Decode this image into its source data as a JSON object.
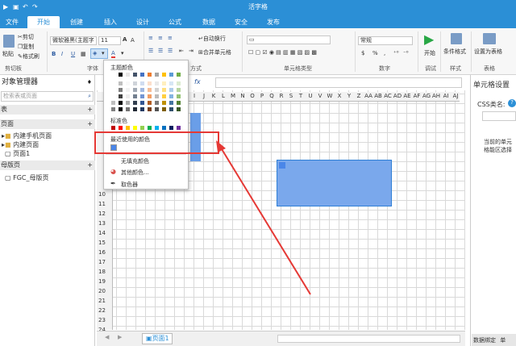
{
  "app": {
    "title": "活字格"
  },
  "menu": {
    "file": "文件",
    "tabs": [
      "开始",
      "创建",
      "插入",
      "设计",
      "公式",
      "数据",
      "安全",
      "发布"
    ]
  },
  "ribbon": {
    "paste": "粘贴",
    "cut": "剪切",
    "copy": "复制",
    "format_painter": "格式刷",
    "font_name": "微软雅黑(主题字",
    "font_size": "11",
    "bold": "B",
    "italic": "I",
    "underline": "U",
    "font_color_letter": "A",
    "auto_wrap": "自动换行",
    "merge_cells": "合并单元格",
    "number_format": "常规",
    "currency": "$",
    "percent": "%",
    "comma": ",",
    "start": "开始",
    "conditional_format": "条件格式",
    "set_table": "设置为表格",
    "groups": {
      "clipboard": "剪切板",
      "font": "字体",
      "alignment": "方式",
      "cell_type": "单元格类型",
      "number": "数字",
      "debug": "调试",
      "style": "样式",
      "table": "表格"
    }
  },
  "left_panel": {
    "title": "对象管理器",
    "pin": "♦",
    "search_placeholder": "检索表或页面",
    "section_table": "表",
    "section_page": "页面",
    "tree": [
      "内建手机页面",
      "内建页面",
      "页面1"
    ],
    "section_master": "母版页",
    "master_item": "FGC_母版页"
  },
  "formula_bar": {
    "fx": "fx"
  },
  "grid": {
    "columns": [
      "I",
      "J",
      "K",
      "L",
      "M",
      "N",
      "O",
      "P",
      "Q",
      "R",
      "S",
      "T",
      "U",
      "V",
      "W",
      "X",
      "Y",
      "Z",
      "AA",
      "AB",
      "AC",
      "AD",
      "AE",
      "AF",
      "AG",
      "AH",
      "AI",
      "AJ"
    ],
    "rows": [
      "10",
      "11",
      "12",
      "13",
      "14",
      "15",
      "16",
      "17",
      "18",
      "19",
      "20",
      "21",
      "22",
      "23",
      "24"
    ]
  },
  "color_popup": {
    "theme_colors_label": "主题颜色",
    "standard_colors_label": "标准色",
    "recent_colors_label": "最近使用的颜色",
    "no_fill": "无填充颜色",
    "more_colors": "其他颜色...",
    "picker": "取色器",
    "theme_row_colors": [
      "#ffffff",
      "#000000",
      "#e7e6e6",
      "#44546a",
      "#4472c4",
      "#ed7d31",
      "#a5a5a5",
      "#ffc000",
      "#5b9bd5",
      "#70ad47"
    ],
    "standard_colors": [
      "#c00000",
      "#ff0000",
      "#ffc000",
      "#ffff00",
      "#92d050",
      "#00b050",
      "#00b0f0",
      "#0070c0",
      "#002060",
      "#7030a0"
    ],
    "recent_color": "#4a86e8"
  },
  "right_panel": {
    "title": "单元格设置",
    "css_label": "CSS类名:",
    "help": "?",
    "hint": "当前的单元格能区选择"
  },
  "bottom": {
    "sheet_tab": "页面1",
    "data_binding": "数据绑定",
    "tab_truncated": "单"
  },
  "colors": {
    "brand": "#2b8fd6",
    "selection_fill": "#6a9ee8",
    "highlight_red": "#e53935"
  }
}
